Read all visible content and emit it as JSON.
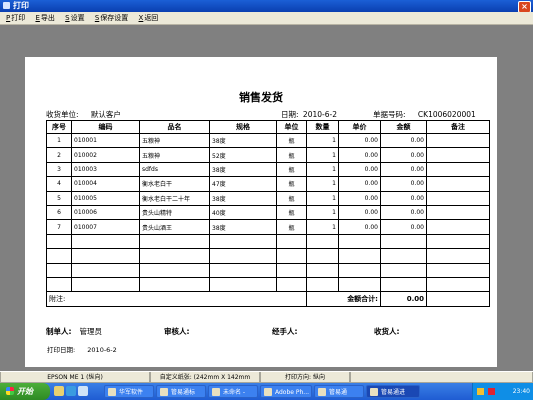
{
  "window": {
    "title": "打印",
    "close_label": "×"
  },
  "toolbar": {
    "items": [
      {
        "key": "P",
        "label": "打印"
      },
      {
        "key": "E",
        "label": "导出"
      },
      {
        "key": "S",
        "label": "设置"
      },
      {
        "key": "S",
        "label": "保存设置"
      },
      {
        "key": "X",
        "label": "返回"
      }
    ]
  },
  "document": {
    "title": "销售发货",
    "customer_label": "收货单位:",
    "customer_value": "默认客户",
    "date_label": "日期:",
    "date_value": "2010-6-2",
    "doc_no_label": "单据号码:",
    "doc_no_value": "CK1006020001",
    "columns": [
      "序号",
      "编码",
      "品名",
      "规格",
      "单位",
      "数量",
      "单价",
      "金额",
      "备注"
    ],
    "rows": [
      {
        "no": "1",
        "code": "010001",
        "name": "五粮神",
        "spec": "38度",
        "unit": "瓶",
        "qty": "1",
        "price": "0.00",
        "amount": "0.00",
        "note": ""
      },
      {
        "no": "2",
        "code": "010002",
        "name": "五粮神",
        "spec": "52度",
        "unit": "瓶",
        "qty": "1",
        "price": "0.00",
        "amount": "0.00",
        "note": ""
      },
      {
        "no": "3",
        "code": "010003",
        "name": "sdfds",
        "spec": "38度",
        "unit": "瓶",
        "qty": "1",
        "price": "0.00",
        "amount": "0.00",
        "note": ""
      },
      {
        "no": "4",
        "code": "010004",
        "name": "衡水老白干",
        "spec": "47度",
        "unit": "瓶",
        "qty": "1",
        "price": "0.00",
        "amount": "0.00",
        "note": ""
      },
      {
        "no": "5",
        "code": "010005",
        "name": "衡水老白干二十年",
        "spec": "38度",
        "unit": "瓶",
        "qty": "1",
        "price": "0.00",
        "amount": "0.00",
        "note": ""
      },
      {
        "no": "6",
        "code": "010006",
        "name": "贵头山精特",
        "spec": "40度",
        "unit": "瓶",
        "qty": "1",
        "price": "0.00",
        "amount": "0.00",
        "note": ""
      },
      {
        "no": "7",
        "code": "010007",
        "name": "贵头山酒王",
        "spec": "38度",
        "unit": "瓶",
        "qty": "1",
        "price": "0.00",
        "amount": "0.00",
        "note": ""
      }
    ],
    "remark_label": "附注:",
    "total_label": "金额合计:",
    "total_value": "0.00",
    "maker_label": "制单人:",
    "maker_value": "管理员",
    "reviewer_label": "审核人:",
    "handler_label": "经手人:",
    "receiver_label": "收货人:",
    "print_date_label": "打印日期:",
    "print_date_value": "2010-6-2"
  },
  "statusbar": {
    "printer": "EPSON ME 1 (纵向)",
    "paper": "自定义纸张: (242mm X 142mm",
    "orientation": "打印方向: 纵向"
  },
  "taskbar": {
    "start_label": "开始",
    "tasks": [
      "华军软件",
      "管易通标",
      "未命名 -",
      "Adobe Ph...",
      "管易通",
      "管易通进"
    ],
    "clock": "23:40"
  },
  "colors": {
    "titlebar": "#0a3fb0",
    "taskbar": "#1f5cd2",
    "start": "#2e8a24",
    "workspace": "#808080"
  }
}
